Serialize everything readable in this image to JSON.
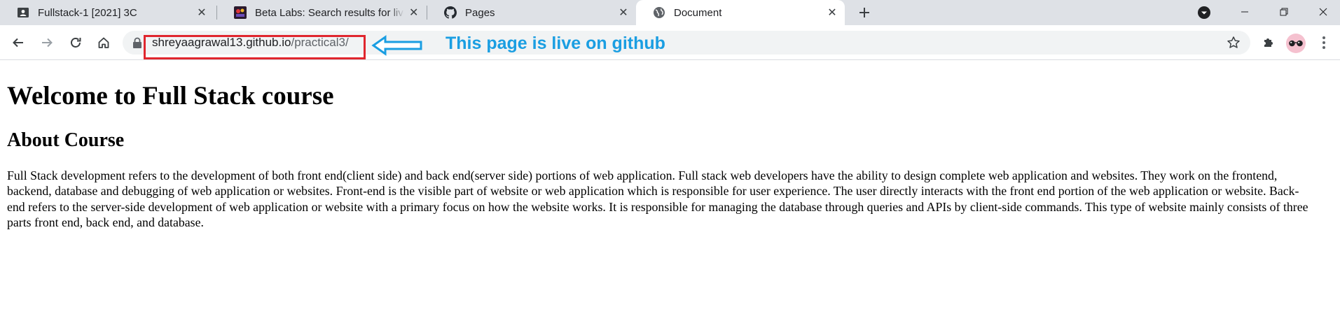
{
  "tabs": [
    {
      "title": "Fullstack-1 [2021] 3C",
      "icon": "classroom-icon"
    },
    {
      "title": "Beta Labs: Search results for live y",
      "icon": "beta-labs-icon"
    },
    {
      "title": "Pages",
      "icon": "github-icon"
    },
    {
      "title": "Document",
      "icon": "globe-icon",
      "active": true
    }
  ],
  "toolbar": {
    "url_host": "shreyaagrawal13.github.io",
    "url_path": "/practical3/"
  },
  "annotation": {
    "text": "This page is live on github",
    "color": "#1a9ee2",
    "box_color": "#e0262e"
  },
  "page": {
    "heading": "Welcome to Full Stack course",
    "subheading": "About Course",
    "paragraph": "Full Stack development refers to the development of both front end(client side) and back end(server side) portions of web application. Full stack web developers have the ability to design complete web application and websites. They work on the frontend, backend, database and debugging of web application or websites. Front-end is the visible part of website or web application which is responsible for user experience. The user directly interacts with the front end portion of the web application or website. Back-end refers to the server-side development of web application or website with a primary focus on how the website works. It is responsible for managing the database through queries and APIs by client-side commands. This type of website mainly consists of three parts front end, back end, and database."
  }
}
